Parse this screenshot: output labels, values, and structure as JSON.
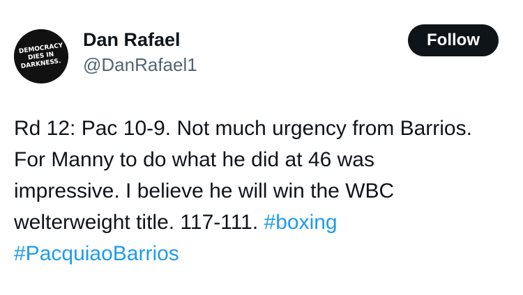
{
  "author": {
    "name": "Dan Rafael",
    "handle": "@DanRafael1",
    "avatar_text": "DEMOCRACY DIES IN DARKNESS."
  },
  "follow_button": {
    "label": "Follow"
  },
  "tweet": {
    "line1": "Rd 12: Pac 10-9. Not much urgency from Barrios.",
    "line2": "For Manny to do what he did at 46 was",
    "line3": "impressive. I believe he will win the WBC",
    "line4_text": "welterweight title. 117-111. ",
    "hashtag1": "#boxing",
    "hashtag2": "#PacquiaoBarrios"
  },
  "colors": {
    "text": "#0f1419",
    "secondary": "#536471",
    "link": "#1d9bf0",
    "button_bg": "#0f1419"
  }
}
